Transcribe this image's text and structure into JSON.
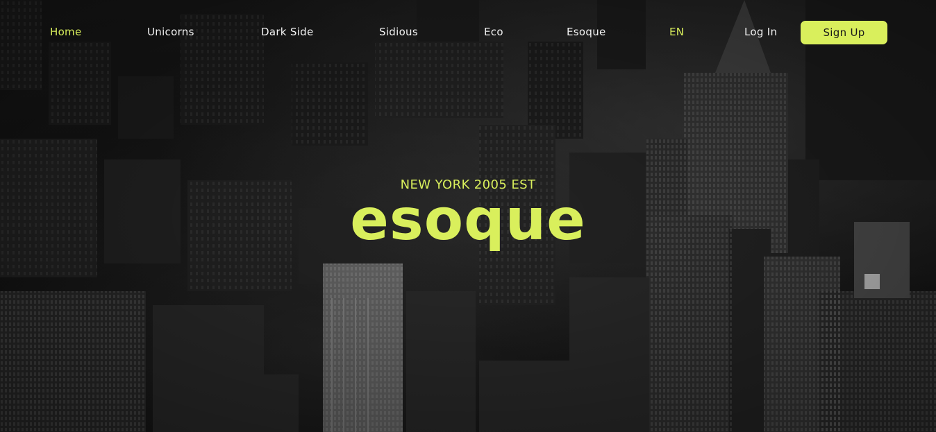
{
  "nav": {
    "items": [
      {
        "label": "Home",
        "active": true
      },
      {
        "label": "Unicorns"
      },
      {
        "label": "Dark Side"
      },
      {
        "label": "Sidious"
      },
      {
        "label": "Eco"
      },
      {
        "label": "Esoque"
      }
    ],
    "language": "EN",
    "login_label": "Log In",
    "signup_label": "Sign Up"
  },
  "hero": {
    "tagline": "NEW YORK 2005 EST",
    "brand": "esoque"
  },
  "colors": {
    "accent": "#d9ef5c",
    "nav_text": "#f2f2f2",
    "background": "#111111"
  }
}
